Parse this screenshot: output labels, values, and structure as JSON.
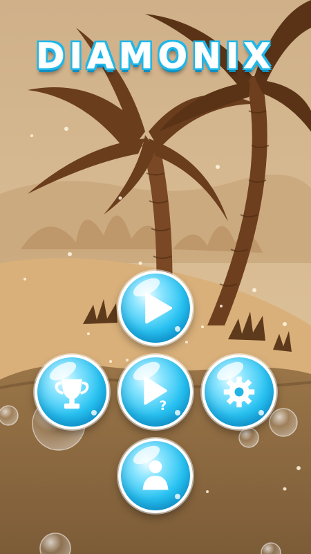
{
  "game": {
    "title": "DIAMONIX"
  },
  "menu": {
    "buttons": [
      {
        "id": "play",
        "icon": "play-icon"
      },
      {
        "id": "leaderboard",
        "icon": "trophy-icon"
      },
      {
        "id": "help",
        "icon": "play-question-icon"
      },
      {
        "id": "settings",
        "icon": "gear-icon"
      },
      {
        "id": "profile",
        "icon": "user-icon"
      }
    ]
  },
  "colors": {
    "sky": "#d9bd8f",
    "sand": "#d7ad76",
    "ground": "#8b6a43",
    "palm": "#6b3f20",
    "button": "#28c3f2",
    "title_outline": "#21b6e8"
  }
}
